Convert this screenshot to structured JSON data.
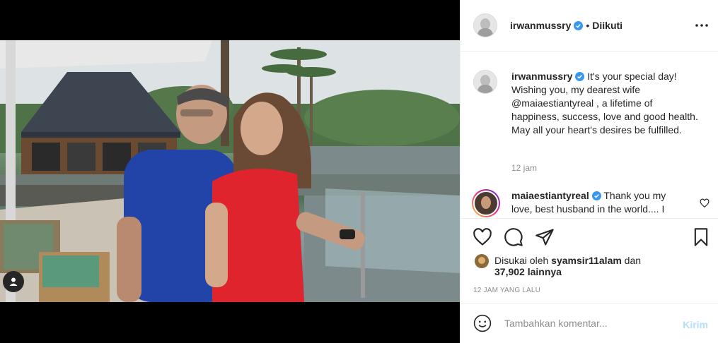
{
  "header": {
    "username": "irwanmussry",
    "separator": "•",
    "follow_state": "Diikuti"
  },
  "caption": {
    "username": "irwanmussry",
    "text_1": " It's your special day! Wishing you, my dearest wife ",
    "mention": "@maiaestiantyreal",
    "text_2": " , a lifetime of happiness, success, love and good health. May all your heart's desires be fulfilled.",
    "time": "12 jam"
  },
  "comment": {
    "username": "maiaestiantyreal",
    "text": " Thank you my love, best husband in the world.... I"
  },
  "likes": {
    "prefix": "Disukai oleh ",
    "liker": "syamsir11alam",
    "joiner": " dan",
    "count": "37,902 lainnya"
  },
  "timestamp": "12 JAM YANG LALU",
  "add_comment": {
    "placeholder": "Tambahkan komentar...",
    "post_label": "Kirim"
  },
  "colors": {
    "verified": "#3897f0",
    "post_disabled": "#b2dffc",
    "muted": "#8e8e8e"
  },
  "icons": [
    "user-tag-icon",
    "verified-badge-icon",
    "more-options-icon",
    "heart-icon",
    "comment-icon",
    "share-icon",
    "bookmark-icon",
    "emoji-icon"
  ]
}
